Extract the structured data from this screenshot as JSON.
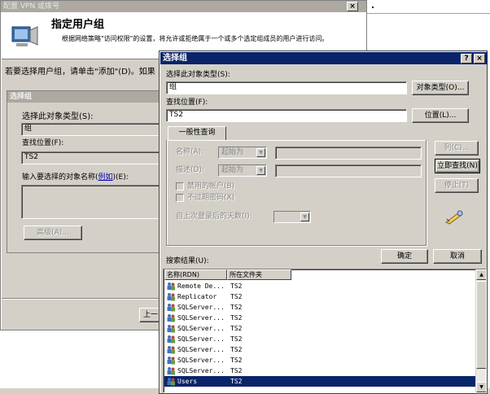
{
  "wizard": {
    "title": "配置 VPN 或拨号",
    "heading": "指定用户组",
    "description": "根据网络策略\"访问权限\"的设置，将允许或拒绝属于一个或多个选定组成员的用户进行访问。",
    "instruction": "若要选择用户组，请单击\"添加\"(D)。如果",
    "back_button": "上一"
  },
  "bg_dialog": {
    "title": "选择组",
    "object_type_label": "选择此对象类型(S):",
    "object_type_value": "组",
    "location_label": "查找位置(F):",
    "location_value": "TS2",
    "names_label_prefix": "输入要选择的对象名称(",
    "names_label_link": "例如",
    "names_label_suffix": ")(E):",
    "advanced_button": "高级(A)..."
  },
  "dialog": {
    "title": "选择组",
    "help_button": "?",
    "close_button": "×",
    "object_type_label": "选择此对象类型(S):",
    "object_type_value": "组",
    "object_type_button": "对象类型(O)...",
    "location_label": "查找位置(F):",
    "location_value": "TS2",
    "location_button": "位置(L)...",
    "tab_label": "一般性查询",
    "name_label": "名称(A):",
    "name_combo": "起始为",
    "desc_label": "描述(D):",
    "desc_combo": "起始为",
    "disabled_accounts": "禁用的帐户(B)",
    "nonexpiring_pw": "不过期密码(X)",
    "days_label": "自上次登录后的天数(I):",
    "columns_button": "列(C)...",
    "find_now_button": "立即查找(N)",
    "stop_button": "停止(T)",
    "ok_button": "确定",
    "cancel_button": "取消",
    "results_label": "搜索结果(U):",
    "col_name": "名称(RDN)",
    "col_folder": "所在文件夹"
  },
  "results": [
    {
      "name": "Remote De...",
      "folder": "TS2"
    },
    {
      "name": "Replicator",
      "folder": "TS2"
    },
    {
      "name": "SQLServer...",
      "folder": "TS2"
    },
    {
      "name": "SQLServer...",
      "folder": "TS2"
    },
    {
      "name": "SQLServer...",
      "folder": "TS2"
    },
    {
      "name": "SQLServer...",
      "folder": "TS2"
    },
    {
      "name": "SQLServer...",
      "folder": "TS2"
    },
    {
      "name": "SQLServer...",
      "folder": "TS2"
    },
    {
      "name": "SQLServer...",
      "folder": "TS2"
    },
    {
      "name": "Users",
      "folder": "TS2",
      "selected": true
    }
  ],
  "colors": {
    "titlebar_active": "#0a246a",
    "face": "#d4d0c8",
    "selection": "#0a246a"
  }
}
